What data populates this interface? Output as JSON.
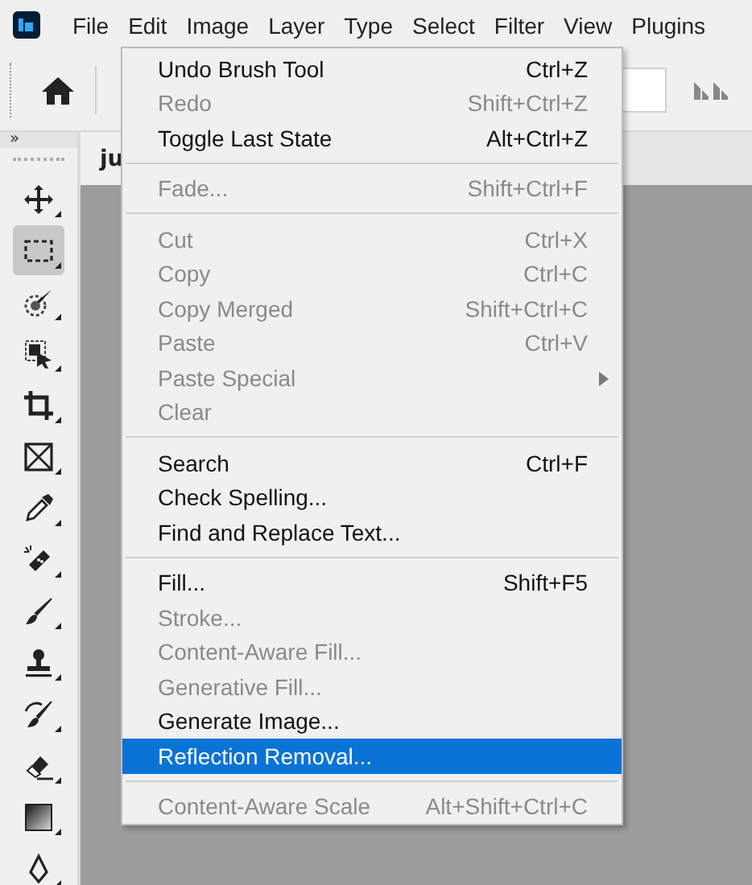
{
  "menubar": [
    {
      "label": "File"
    },
    {
      "label": "Edit"
    },
    {
      "label": "Image"
    },
    {
      "label": "Layer"
    },
    {
      "label": "Type"
    },
    {
      "label": "Select"
    },
    {
      "label": "Filter"
    },
    {
      "label": "View"
    },
    {
      "label": "Plugins"
    }
  ],
  "toolbar": {
    "collapse": "»",
    "tools": [
      {
        "kind": "move",
        "selected": false
      },
      {
        "kind": "marquee",
        "selected": true
      },
      {
        "kind": "quick-select",
        "selected": false
      },
      {
        "kind": "object-select",
        "selected": false
      },
      {
        "kind": "crop",
        "selected": false
      },
      {
        "kind": "frame",
        "selected": false
      },
      {
        "kind": "eyedropper",
        "selected": false
      },
      {
        "kind": "healing",
        "selected": false
      },
      {
        "kind": "brush",
        "selected": false
      },
      {
        "kind": "stamp",
        "selected": false
      },
      {
        "kind": "history-brush",
        "selected": false
      },
      {
        "kind": "eraser",
        "selected": false
      },
      {
        "kind": "gradient",
        "selected": false
      },
      {
        "kind": "pen",
        "selected": false
      }
    ]
  },
  "document_tab": {
    "title": "ju"
  },
  "edit_menu": [
    {
      "kind": "item",
      "label": "Undo Brush Tool",
      "shortcut": "Ctrl+Z",
      "disabled": false,
      "selected": false
    },
    {
      "kind": "item",
      "label": "Redo",
      "shortcut": "Shift+Ctrl+Z",
      "disabled": true,
      "selected": false
    },
    {
      "kind": "item",
      "label": "Toggle Last State",
      "shortcut": "Alt+Ctrl+Z",
      "disabled": false,
      "selected": false
    },
    {
      "kind": "separator"
    },
    {
      "kind": "item",
      "label": "Fade...",
      "shortcut": "Shift+Ctrl+F",
      "disabled": true,
      "selected": false
    },
    {
      "kind": "separator"
    },
    {
      "kind": "item",
      "label": "Cut",
      "shortcut": "Ctrl+X",
      "disabled": true,
      "selected": false
    },
    {
      "kind": "item",
      "label": "Copy",
      "shortcut": "Ctrl+C",
      "disabled": true,
      "selected": false
    },
    {
      "kind": "item",
      "label": "Copy Merged",
      "shortcut": "Shift+Ctrl+C",
      "disabled": true,
      "selected": false
    },
    {
      "kind": "item",
      "label": "Paste",
      "shortcut": "Ctrl+V",
      "disabled": true,
      "selected": false
    },
    {
      "kind": "submenu",
      "label": "Paste Special",
      "disabled": true,
      "selected": false
    },
    {
      "kind": "item",
      "label": "Clear",
      "disabled": true,
      "selected": false
    },
    {
      "kind": "separator"
    },
    {
      "kind": "item",
      "label": "Search",
      "shortcut": "Ctrl+F",
      "disabled": false,
      "selected": false
    },
    {
      "kind": "item",
      "label": "Check Spelling...",
      "disabled": false,
      "selected": false
    },
    {
      "kind": "item",
      "label": "Find and Replace Text...",
      "disabled": false,
      "selected": false
    },
    {
      "kind": "separator"
    },
    {
      "kind": "item",
      "label": "Fill...",
      "shortcut": "Shift+F5",
      "disabled": false,
      "selected": false
    },
    {
      "kind": "item",
      "label": "Stroke...",
      "disabled": true,
      "selected": false
    },
    {
      "kind": "item",
      "label": "Content-Aware Fill...",
      "disabled": true,
      "selected": false
    },
    {
      "kind": "item",
      "label": "Generative Fill...",
      "disabled": true,
      "selected": false
    },
    {
      "kind": "item",
      "label": "Generate Image...",
      "disabled": false,
      "selected": false
    },
    {
      "kind": "item",
      "label": "Reflection Removal...",
      "disabled": false,
      "selected": true
    },
    {
      "kind": "separator"
    },
    {
      "kind": "item",
      "label": "Content-Aware Scale",
      "shortcut": "Alt+Shift+Ctrl+C",
      "disabled": true,
      "selected": false
    }
  ]
}
